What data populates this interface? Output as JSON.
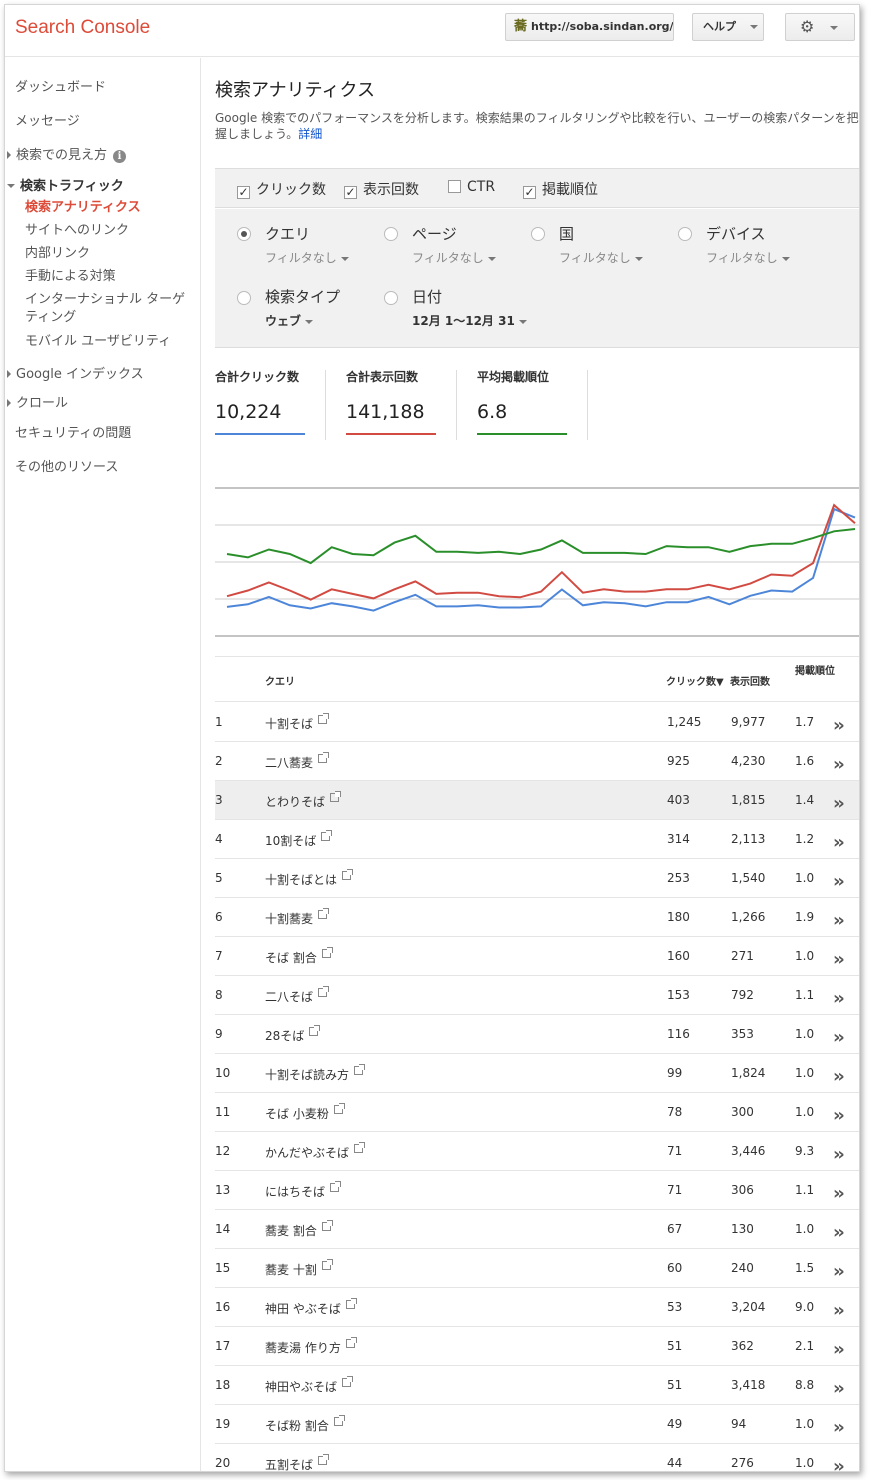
{
  "header": {
    "app_title": "Search Console",
    "site": "http://soba.sindan.org/",
    "site_icon": "蕎",
    "help_label": "ヘルプ"
  },
  "sidebar": {
    "dashboard": "ダッシュボード",
    "messages": "メッセージ",
    "search_appearance": "検索での見え方",
    "search_traffic": "検索トラフィック",
    "sub": {
      "analytics": "検索アナリティクス",
      "links_to_site": "サイトへのリンク",
      "internal_links": "内部リンク",
      "manual_actions": "手動による対策",
      "international": "インターナショナル ターゲティング",
      "mobile": "モバイル ユーザビリティ"
    },
    "google_index": "Google インデックス",
    "crawl": "クロール",
    "security": "セキュリティの問題",
    "other": "その他のリソース"
  },
  "page": {
    "title": "検索アナリティクス",
    "desc": "Google 検索でのパフォーマンスを分析します。検索結果のフィルタリングや比較を行い、ユーザーの検索パターンを把握しましょう。",
    "desc_link": "詳細"
  },
  "metrics": {
    "clicks": "クリック数",
    "impressions": "表示回数",
    "ctr": "CTR",
    "position": "掲載順位"
  },
  "filters": {
    "query": "クエリ",
    "page": "ページ",
    "country": "国",
    "device": "デバイス",
    "no_filter": "フィルタなし",
    "search_type": "検索タイプ",
    "search_type_value": "ウェブ",
    "date": "日付",
    "date_value": "12月 1〜12月 31"
  },
  "kpis": {
    "total_clicks_label": "合計クリック数",
    "total_clicks": "10,224",
    "total_impressions_label": "合計表示回数",
    "total_impressions": "141,188",
    "avg_position_label": "平均掲載順位",
    "avg_position": "6.8"
  },
  "colors": {
    "clicks": "#4d86d9",
    "impressions": "#d14b43",
    "position": "#2a8f2a",
    "brand": "#dd4b39"
  },
  "chart_data": {
    "type": "line",
    "title": "",
    "xlabel": "",
    "ylabel": "",
    "grid": true,
    "x": [
      1,
      2,
      3,
      4,
      5,
      6,
      7,
      8,
      9,
      10,
      11,
      12,
      13,
      14,
      15,
      16,
      17,
      18,
      19,
      20,
      21,
      22,
      23,
      24,
      25,
      26,
      27,
      28,
      29,
      30,
      31
    ],
    "series": [
      {
        "name": "クリック数",
        "values": [
          275,
          300,
          370,
          290,
          260,
          310,
          280,
          240,
          320,
          390,
          280,
          280,
          290,
          270,
          270,
          280,
          440,
          290,
          320,
          310,
          280,
          320,
          320,
          370,
          300,
          380,
          430,
          420,
          550,
          1200,
          1120
        ]
      },
      {
        "name": "表示回数",
        "values": [
          3500,
          4000,
          4700,
          4000,
          3200,
          4100,
          3700,
          3300,
          4100,
          4800,
          3700,
          3800,
          3800,
          3500,
          3400,
          3900,
          5600,
          3800,
          4100,
          3900,
          3900,
          4100,
          4100,
          4500,
          4100,
          4600,
          5400,
          5300,
          6400,
          11500,
          9900
        ]
      },
      {
        "name": "掲載順位",
        "values": [
          7.2,
          6.9,
          7.6,
          7.2,
          6.4,
          7.8,
          7.2,
          7.1,
          8.2,
          8.8,
          7.4,
          7.4,
          7.3,
          7.4,
          7.2,
          7.6,
          8.4,
          7.3,
          7.3,
          7.3,
          7.2,
          7.9,
          7.8,
          7.8,
          7.4,
          7.9,
          8.1,
          8.1,
          8.6,
          9.2,
          9.4
        ]
      }
    ]
  },
  "table": {
    "headers": {
      "query": "クエリ",
      "clicks": "クリック数▼",
      "impressions": "表示回数",
      "position": "掲載順位"
    },
    "rows": [
      {
        "n": "1",
        "q": "十割そば",
        "c": "1,245",
        "i": "9,977",
        "p": "1.7"
      },
      {
        "n": "2",
        "q": "二八蕎麦",
        "c": "925",
        "i": "4,230",
        "p": "1.6"
      },
      {
        "n": "3",
        "q": "とわりそば",
        "c": "403",
        "i": "1,815",
        "p": "1.4"
      },
      {
        "n": "4",
        "q": "10割そば",
        "c": "314",
        "i": "2,113",
        "p": "1.2"
      },
      {
        "n": "5",
        "q": "十割そばとは",
        "c": "253",
        "i": "1,540",
        "p": "1.0"
      },
      {
        "n": "6",
        "q": "十割蕎麦",
        "c": "180",
        "i": "1,266",
        "p": "1.9"
      },
      {
        "n": "7",
        "q": "そば 割合",
        "c": "160",
        "i": "271",
        "p": "1.0"
      },
      {
        "n": "8",
        "q": "二八そば",
        "c": "153",
        "i": "792",
        "p": "1.1"
      },
      {
        "n": "9",
        "q": "28そば",
        "c": "116",
        "i": "353",
        "p": "1.0"
      },
      {
        "n": "10",
        "q": "十割そば読み方",
        "c": "99",
        "i": "1,824",
        "p": "1.0"
      },
      {
        "n": "11",
        "q": "そば 小麦粉",
        "c": "78",
        "i": "300",
        "p": "1.0"
      },
      {
        "n": "12",
        "q": "かんだやぶそば",
        "c": "71",
        "i": "3,446",
        "p": "9.3"
      },
      {
        "n": "13",
        "q": "にはちそば",
        "c": "71",
        "i": "306",
        "p": "1.1"
      },
      {
        "n": "14",
        "q": "蕎麦 割合",
        "c": "67",
        "i": "130",
        "p": "1.0"
      },
      {
        "n": "15",
        "q": "蕎麦 十割",
        "c": "60",
        "i": "240",
        "p": "1.5"
      },
      {
        "n": "16",
        "q": "神田 やぶそば",
        "c": "53",
        "i": "3,204",
        "p": "9.0"
      },
      {
        "n": "17",
        "q": "蕎麦湯 作り方",
        "c": "51",
        "i": "362",
        "p": "2.1"
      },
      {
        "n": "18",
        "q": "神田やぶそば",
        "c": "51",
        "i": "3,418",
        "p": "8.8"
      },
      {
        "n": "19",
        "q": "そば粉 割合",
        "c": "49",
        "i": "94",
        "p": "1.0"
      },
      {
        "n": "20",
        "q": "五割そば",
        "c": "44",
        "i": "276",
        "p": "1.0"
      }
    ]
  }
}
